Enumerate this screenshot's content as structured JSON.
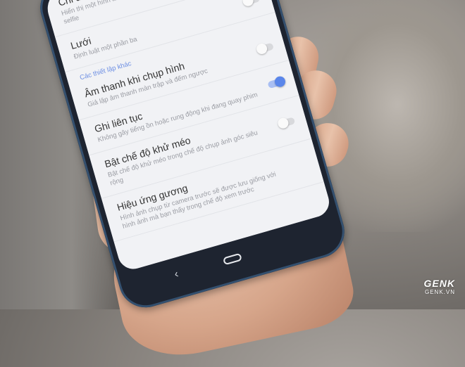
{
  "settings": {
    "items": [
      {
        "title": "Chỉ dẫn selfie",
        "desc": "Hiển thị một hình ảnh chỉ dẫn người dùng khi chụp ảnh selfie",
        "toggle": null
      },
      {
        "title": "Lưới",
        "desc": "Định luật một phần ba",
        "toggle": false
      },
      {
        "title": "Âm thanh khi chụp hình",
        "desc": "Giả lập âm thanh màn trập và đếm ngược",
        "toggle": false
      },
      {
        "title": "Ghi liên tục",
        "desc": "Không gây tiếng ồn hoặc rung động khi đang quay phim",
        "toggle": true
      },
      {
        "title": "Bật chế độ khử méo",
        "desc": "Bật chế độ khử méo trong chế độ chụp ảnh góc siêu rộng",
        "toggle": false
      },
      {
        "title": "Hiệu ứng gương",
        "desc": "Hình ảnh chụp từ camera trước sẽ được lưu giống với hình ảnh mà bạn thấy trong chế độ xem trước",
        "toggle": null
      }
    ],
    "section_header": "Các thiết lập khác"
  },
  "navbar": {
    "back_glyph": "‹"
  },
  "watermark": {
    "logo": "GENK",
    "site": "GENK.VN"
  },
  "colors": {
    "accent": "#5a86ea",
    "screen_bg": "#f1f2f5",
    "phone_body": "#1e2430"
  }
}
